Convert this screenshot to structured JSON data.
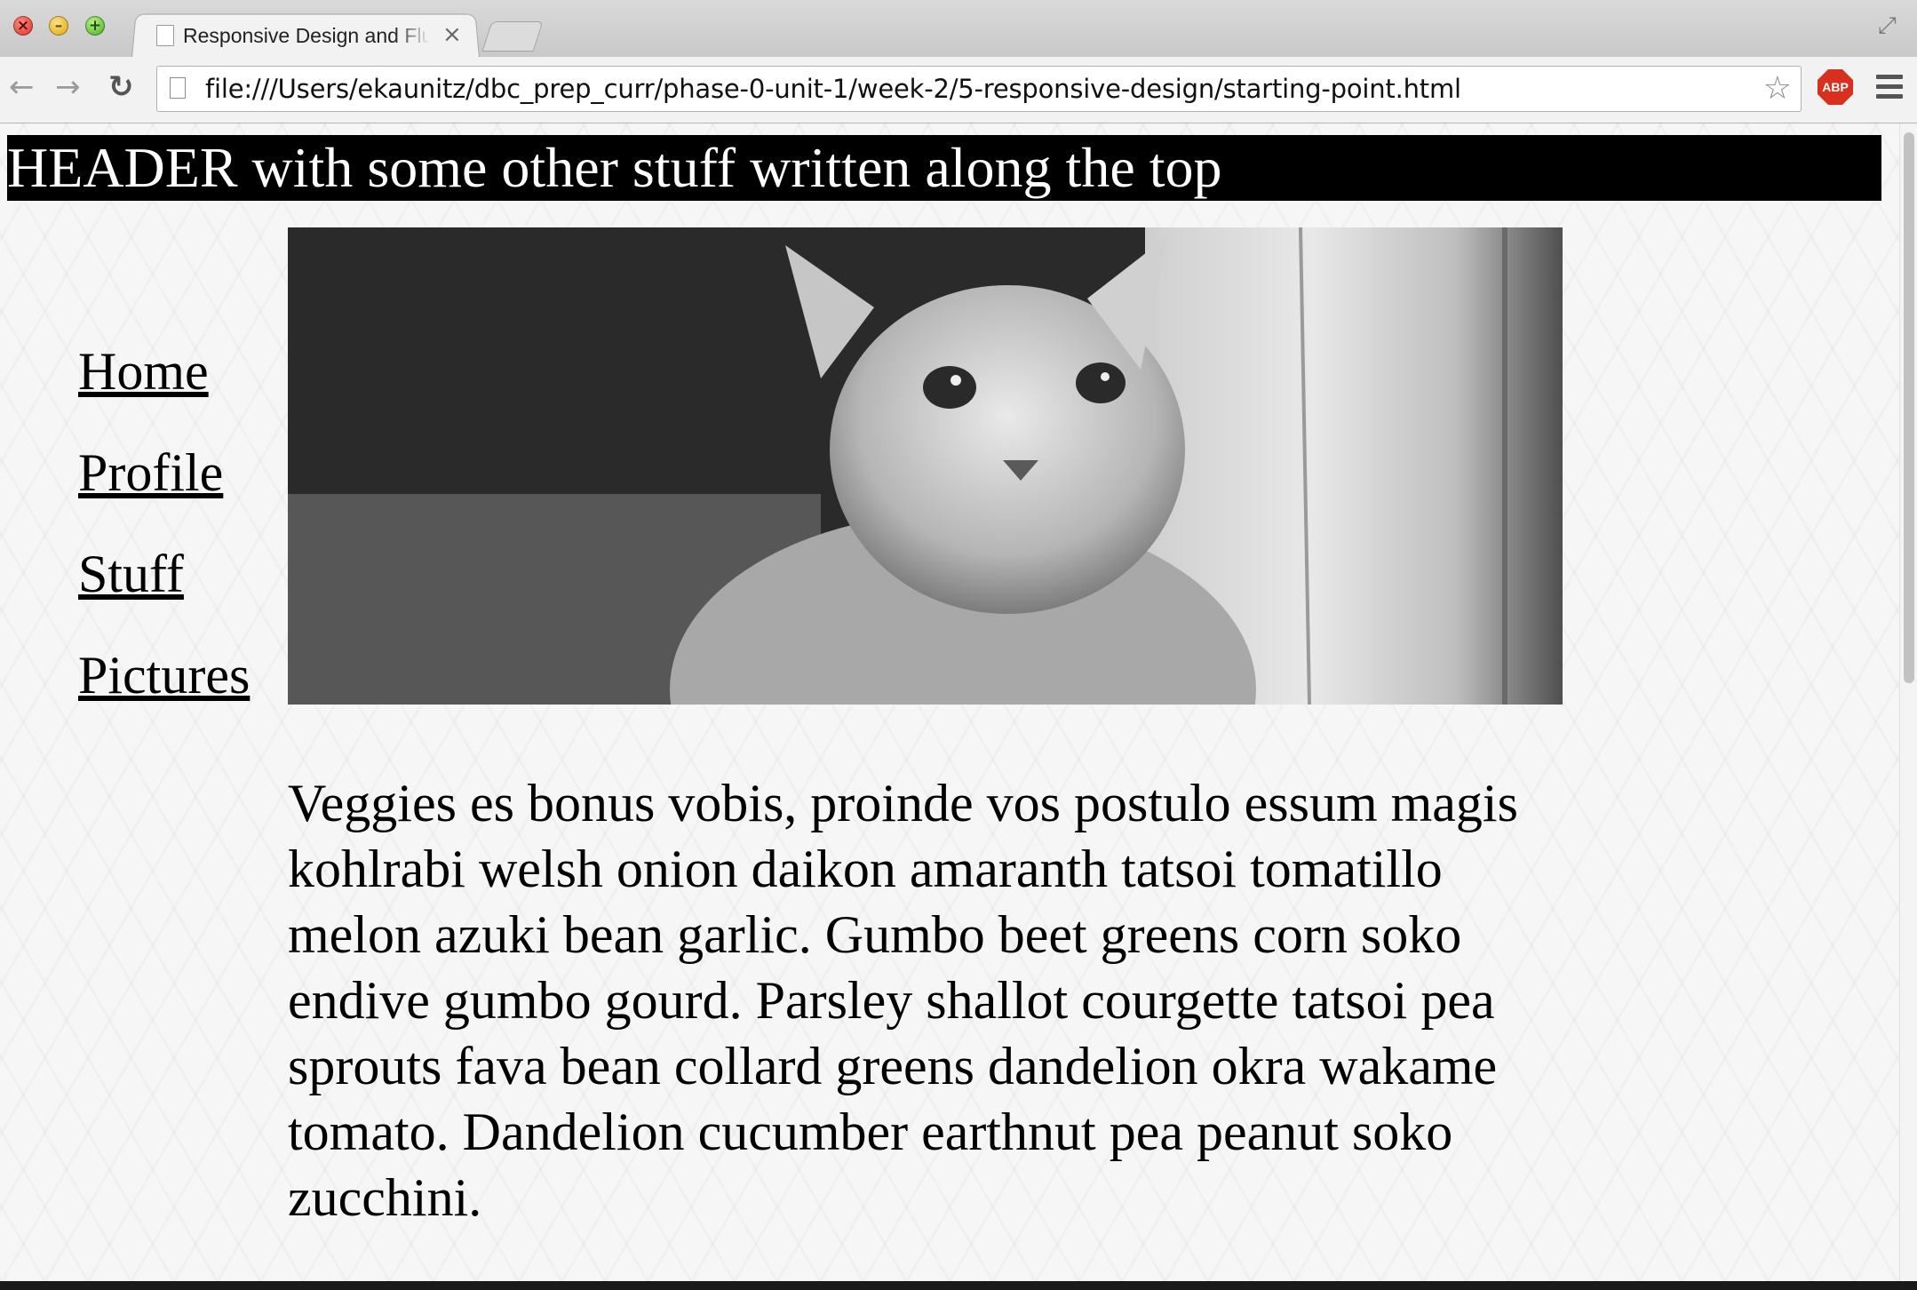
{
  "browser": {
    "tab_title": "Responsive Design and Fluid Layouts",
    "tab_close": "×",
    "url": "file:///Users/ekaunitz/dbc_prep_curr/phase-0-unit-1/week-2/5-responsive-design/starting-point.html",
    "back_glyph": "←",
    "forward_glyph": "→",
    "reload_glyph": "↻",
    "star_glyph": "☆",
    "fullscreen_glyph": "⤢",
    "extension_label": "ABP",
    "window_buttons": {
      "close": "×",
      "minimize": "–",
      "maximize": "+"
    },
    "icons": [
      "close-icon",
      "minimize-icon",
      "maximize-icon",
      "page-icon",
      "back-arrow-icon",
      "forward-arrow-icon",
      "reload-icon",
      "bookmark-star-icon",
      "adblock-plus-icon",
      "menu-icon",
      "fullscreen-icon"
    ]
  },
  "page": {
    "header": "HEADER with some other stuff written along the top",
    "nav": [
      "Home",
      "Profile",
      "Stuff",
      "Pictures"
    ],
    "hero_image": "grayscale photo of a kitten peeking beside a wooden post",
    "paragraph": "Veggies es bonus vobis, proinde vos postulo essum magis kohlrabi welsh onion daikon amaranth tatsoi tomatillo melon azuki bean garlic. Gumbo beet greens corn soko endive gumbo gourd. Parsley shallot courgette tatsoi pea sprouts fava bean collard greens dandelion okra wakame tomato. Dandelion cucumber earthnut pea peanut soko zucchini."
  },
  "colors": {
    "header_bg": "#000000",
    "header_text": "#ffffff",
    "extension_red": "#d8301f"
  }
}
